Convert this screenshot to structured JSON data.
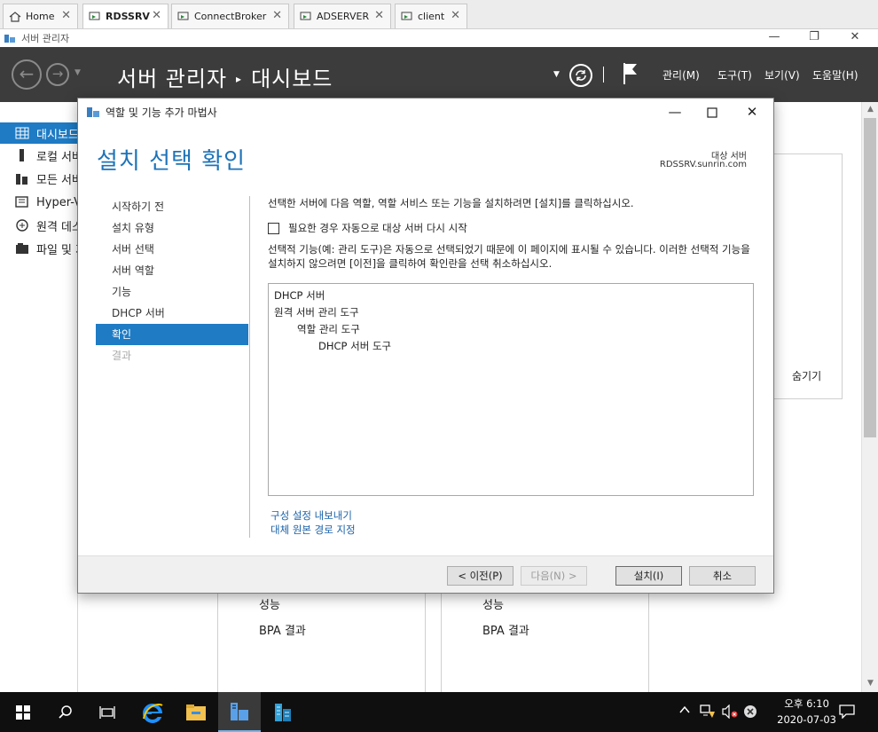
{
  "tabs": [
    {
      "label": "Home",
      "icon": "home-icon"
    },
    {
      "label": "RDSSRV",
      "icon": "vm-icon"
    },
    {
      "label": "ConnectBroker",
      "icon": "vm-icon"
    },
    {
      "label": "ADSERVER",
      "icon": "vm-icon"
    },
    {
      "label": "client",
      "icon": "vm-icon"
    }
  ],
  "tab_close": "✕",
  "window": {
    "title": "서버 관리자",
    "minimize": "—",
    "maximize": "❐",
    "close": "✕"
  },
  "header": {
    "crumb_root": "서버 관리자",
    "crumb_sep": "▸",
    "crumb_page": "대시보드",
    "menus": {
      "manage": "관리(M)",
      "tools": "도구(T)",
      "view": "보기(V)",
      "help": "도움말(H)"
    }
  },
  "sidebar": {
    "items": [
      {
        "label": "대시보드",
        "icon": "dashboard-icon"
      },
      {
        "label": "로컬 서버",
        "icon": "local-server-icon"
      },
      {
        "label": "모든 서버",
        "icon": "all-servers-icon"
      },
      {
        "label": "Hyper-V",
        "icon": "hyperv-icon"
      },
      {
        "label": "원격 데스크톱 서비스",
        "icon": "remote-desktop-icon"
      },
      {
        "label": "파일 및 저장소 서비스",
        "icon": "file-storage-icon"
      }
    ]
  },
  "dashboard": {
    "hide_link": "숨기기",
    "tile_left": {
      "performance": "성능",
      "bpa": "BPA 결과"
    },
    "tile_right": {
      "performance": "성능",
      "bpa": "BPA 결과"
    }
  },
  "wizard": {
    "title": "역할 및 기능 추가 마법사",
    "heading": "설치 선택 확인",
    "target_label": "대상 서버",
    "target_value": "RDSSRV.sunrin.com",
    "steps": [
      "시작하기 전",
      "설치 유형",
      "서버 선택",
      "서버 역할",
      "기능",
      "DHCP 서버",
      "확인",
      "결과"
    ],
    "active_step_index": 6,
    "instruction": "선택한 서버에 다음 역할, 역할 서비스 또는 기능을 설치하려면 [설치]를 클릭하십시오.",
    "restart_checkbox_label": "필요한 경우 자동으로 대상 서버 다시 시작",
    "restart_checked": false,
    "note": "선택적 기능(예: 관리 도구)은 자동으로 선택되었기 때문에 이 페이지에 표시될 수 있습니다. 이러한 선택적 기능을 설치하지 않으려면 [이전]을 클릭하여 확인란을 선택 취소하십시오.",
    "selections": [
      {
        "label": "DHCP 서버",
        "level": 0
      },
      {
        "label": "원격 서버 관리 도구",
        "level": 0
      },
      {
        "label": "역할 관리 도구",
        "level": 1
      },
      {
        "label": "DHCP 서버 도구",
        "level": 2
      }
    ],
    "links": {
      "export": "구성 설정 내보내기",
      "alt_source": "대체 원본 경로 지정"
    },
    "buttons": {
      "previous": "< 이전(P)",
      "next": "다음(N) >",
      "install": "설치(I)",
      "cancel": "취소"
    }
  },
  "taskbar": {
    "clock_time": "오후 6:10",
    "clock_date": "2020-07-03",
    "tray_chevron": "^"
  },
  "colors": {
    "accent": "#1e7bc4",
    "heading": "#1e73b8",
    "header_bg": "#3c3c3c",
    "taskbar_bg": "#0f0f0f"
  }
}
